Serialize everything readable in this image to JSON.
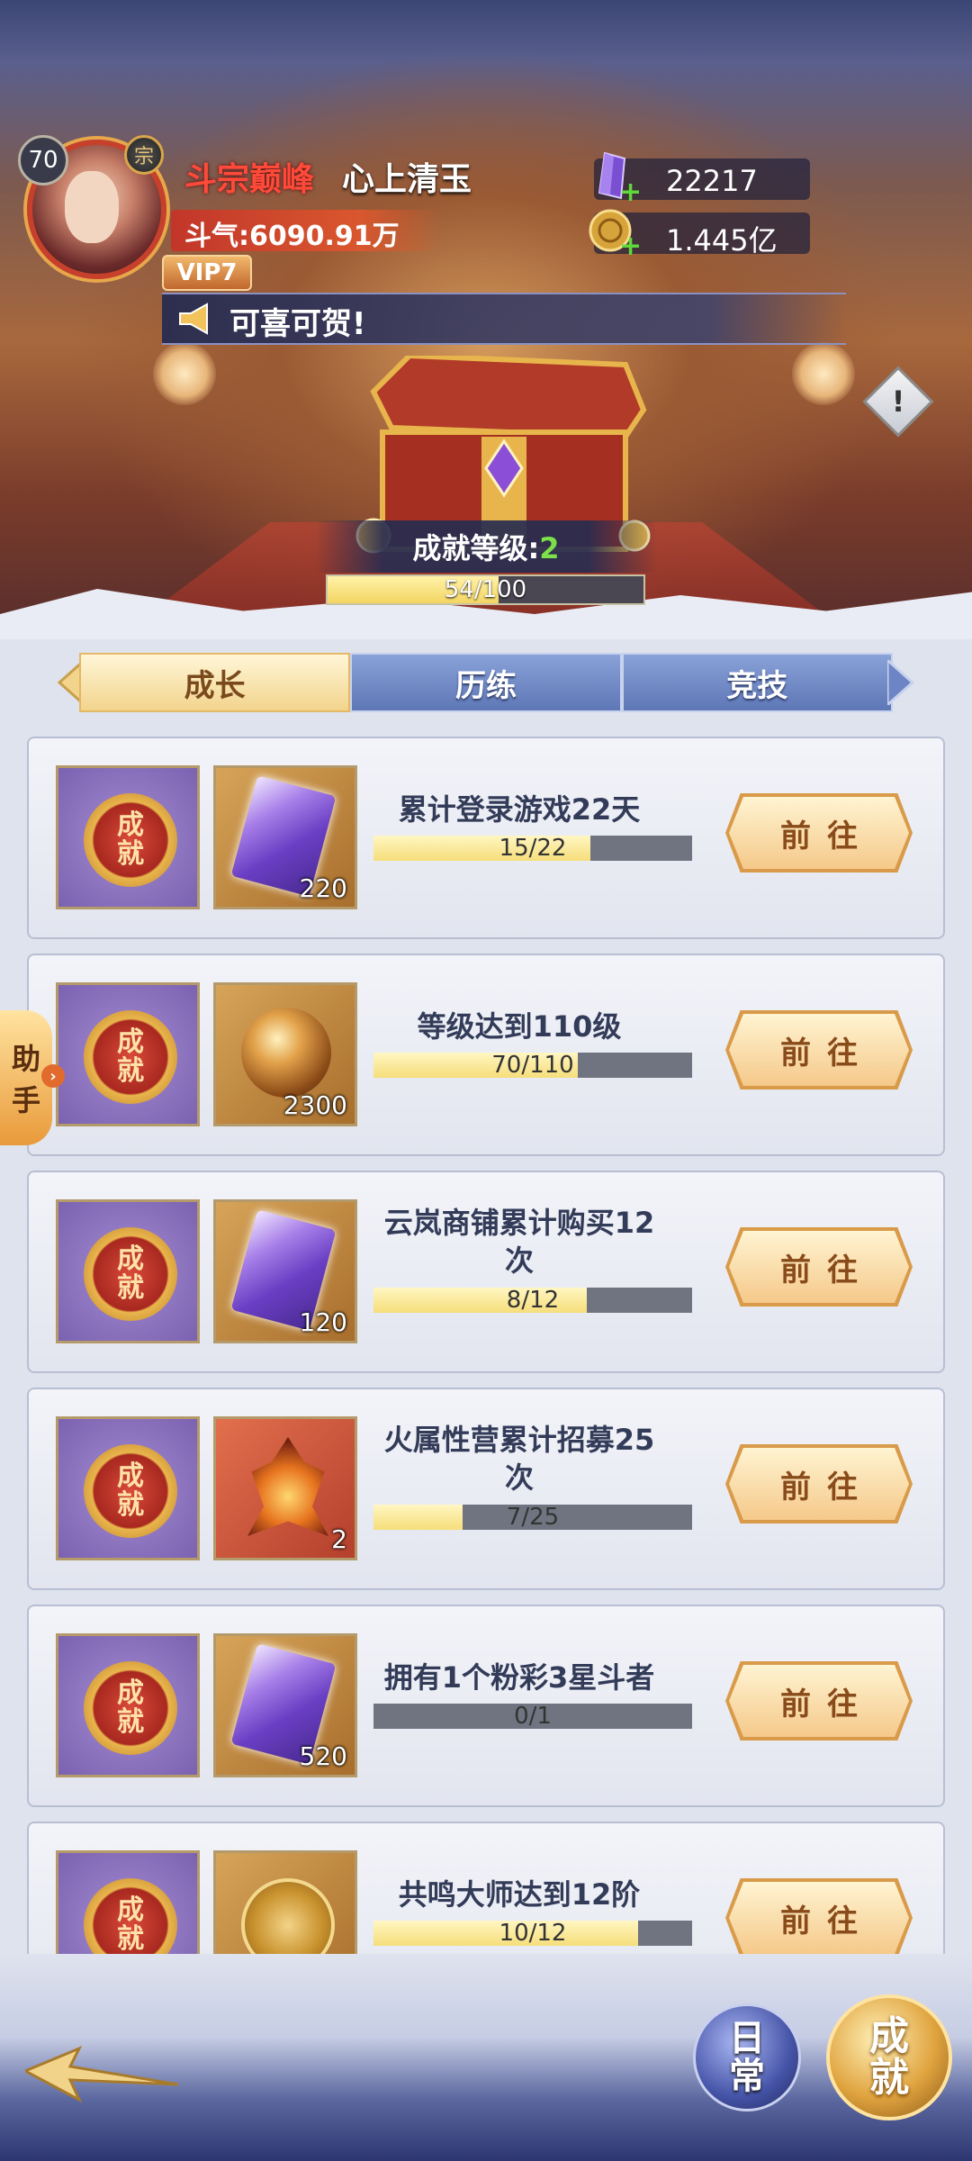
{
  "player": {
    "level": "70",
    "rank_glyph": "宗",
    "title": "斗宗巅峰",
    "name": "心上清玉",
    "power": "斗气:6090.91万",
    "vip": "VIP7"
  },
  "currencies": [
    {
      "name": "purple-crystal",
      "value": "22217",
      "color": "#7a4fd1"
    },
    {
      "name": "gold-coin",
      "value": "1.445亿",
      "color": "#d6a43a"
    }
  ],
  "announcement": "可喜可贺!",
  "info_button": "!",
  "achievement": {
    "label": "成就等级:",
    "level": "2",
    "progress_text": "54/100",
    "progress": 0.54
  },
  "tabs": [
    {
      "label": "成长",
      "active": true
    },
    {
      "label": "历练",
      "active": false
    },
    {
      "label": "竞技",
      "active": false
    }
  ],
  "helper": {
    "label_top": "助",
    "label_bottom": "手"
  },
  "medal_text": {
    "top": "成",
    "bottom": "就"
  },
  "go_label": "前往",
  "tasks": [
    {
      "title": "累计登录游戏22天",
      "reward_icon": "purple-crystal-icon",
      "reward_qty": "220",
      "progress_text": "15/22",
      "progress": 0.68
    },
    {
      "title": "等级达到110级",
      "reward_icon": "gold-orb-icon",
      "reward_qty": "2300",
      "progress_text": "70/110",
      "progress": 0.64
    },
    {
      "title": "云岚商铺累计购买12次",
      "reward_icon": "purple-crystal-icon",
      "reward_qty": "120",
      "progress_text": "8/12",
      "progress": 0.67
    },
    {
      "title": "火属性营累计招募25次",
      "reward_icon": "fire-emblem-icon",
      "reward_qty": "2",
      "progress_text": "7/25",
      "progress": 0.28
    },
    {
      "title": "拥有1个粉彩3星斗者",
      "reward_icon": "purple-crystal-icon",
      "reward_qty": "520",
      "progress_text": "0/1",
      "progress": 0
    },
    {
      "title": "共鸣大师达到12阶",
      "reward_icon": "gold-coin-icon",
      "reward_qty": "",
      "progress_text": "10/12",
      "progress": 0.83
    }
  ],
  "bottom_nav": {
    "daily": {
      "top": "日",
      "bottom": "常"
    },
    "achievement": {
      "top": "成",
      "bottom": "就"
    }
  }
}
